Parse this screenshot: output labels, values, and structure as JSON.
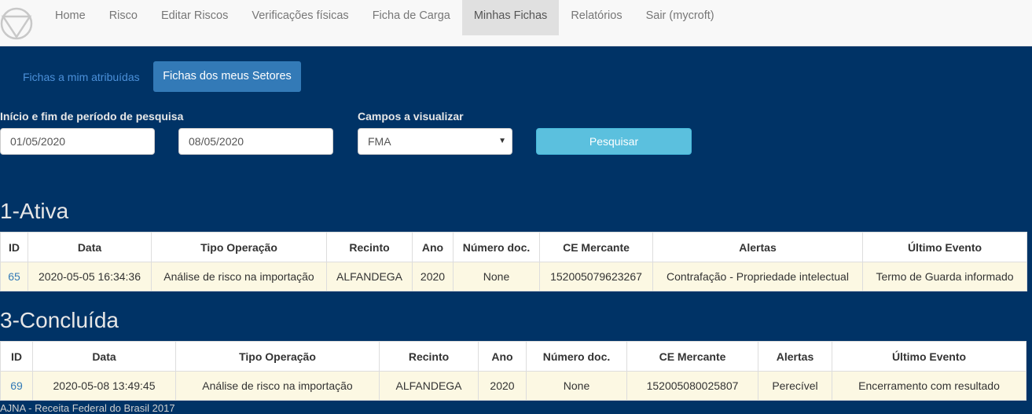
{
  "nav": {
    "items": [
      "Home",
      "Risco",
      "Editar Riscos",
      "Verificações físicas",
      "Ficha de Carga",
      "Minhas Fichas",
      "Relatórios",
      "Sair (mycroft)"
    ],
    "active": "Minhas Fichas"
  },
  "tabs": [
    "Fichas a mim atribuídas",
    "Fichas dos meus Setores"
  ],
  "search": {
    "period_label": "Início e fim de período de pesquisa",
    "start": "01/05/2020",
    "end": "08/05/2020",
    "fields_label": "Campos a visualizar",
    "fields_value": "FMA",
    "button": "Pesquisar"
  },
  "sections": [
    {
      "title": "1-Ativa",
      "headers": [
        "ID",
        "Data",
        "Tipo Operação",
        "Recinto",
        "Ano",
        "Número doc.",
        "CE Mercante",
        "Alertas",
        "Último Evento"
      ],
      "rows": [
        [
          "65",
          "2020-05-05 16:34:36",
          "Análise de risco na importação",
          "ALFANDEGA",
          "2020",
          "None",
          "152005079623267",
          "Contrafação - Propriedade intelectual",
          "Termo de Guarda informado"
        ]
      ]
    },
    {
      "title": "3-Concluída",
      "headers": [
        "ID",
        "Data",
        "Tipo Operação",
        "Recinto",
        "Ano",
        "Número doc.",
        "CE Mercante",
        "Alertas",
        "Último Evento"
      ],
      "rows": [
        [
          "69",
          "2020-05-08 13:49:45",
          "Análise de risco na importação",
          "ALFANDEGA",
          "2020",
          "None",
          "152005080025807",
          "Perecível",
          "Encerramento com resultado"
        ]
      ]
    }
  ],
  "footer": "AJNA - Receita Federal do Brasil 2017",
  "colors": {
    "background": "#003366",
    "primary": "#337ab7",
    "info": "#5bc0de",
    "row_highlight": "#fcf8e3"
  },
  "icons": [
    "ajna-logo-icon",
    "caret-down-icon"
  ]
}
